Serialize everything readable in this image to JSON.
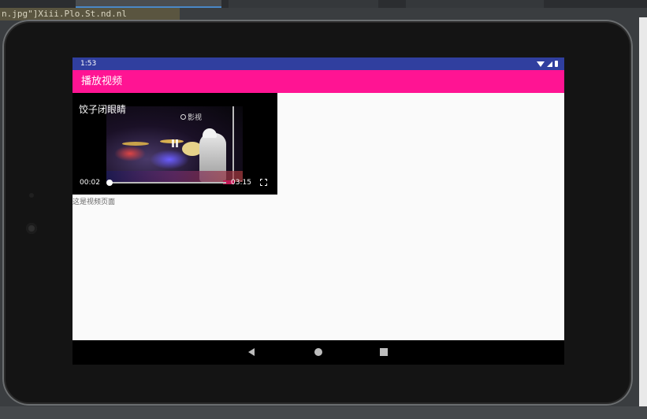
{
  "ide": {
    "strip_text": "n.jpg\"]Xiii.Plo.St.nd.nl"
  },
  "status_bar": {
    "time": "1:53"
  },
  "app_bar": {
    "title": "播放视频"
  },
  "player": {
    "title": "饺子闭眼睛",
    "watermark": "影视",
    "current_time": "00:02",
    "total_time": "03:15",
    "progress": 0.01
  },
  "page": {
    "text": "这是视频页面"
  },
  "icons": {
    "status": [
      "wifi-icon",
      "signal-icon",
      "battery-icon"
    ],
    "player": [
      "pause-icon",
      "fullscreen-icon"
    ],
    "nav": [
      "back-icon",
      "home-icon",
      "recent-apps-icon"
    ]
  },
  "colors": {
    "status_bar": "#303f9f",
    "app_bar": "#ff1493",
    "screen_bg": "#fafafa"
  }
}
